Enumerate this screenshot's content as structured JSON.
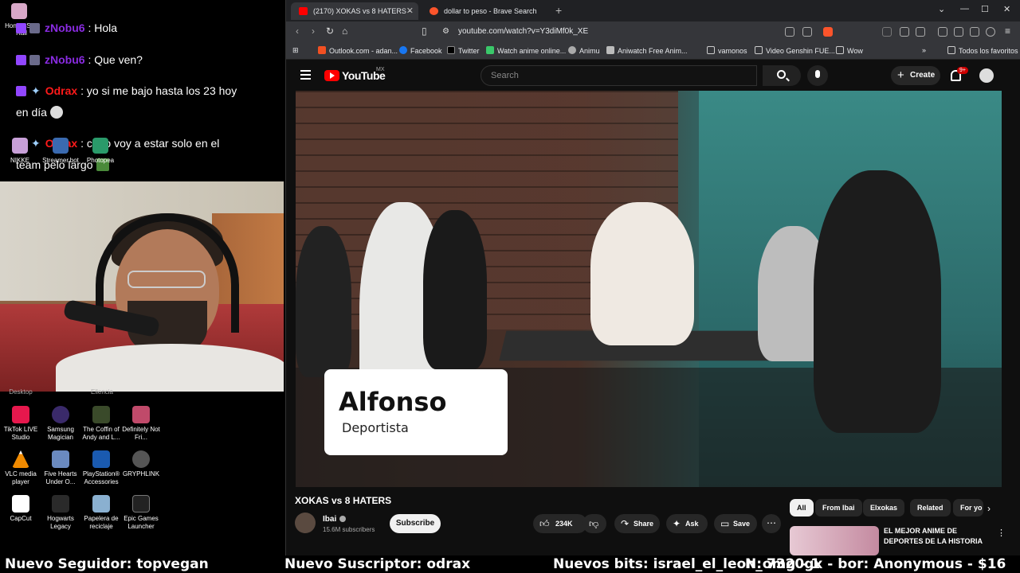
{
  "chat": [
    {
      "user": "zNobu6",
      "message": ": Hola"
    },
    {
      "user": "zNobu6",
      "message": ": Que ven?"
    },
    {
      "user": "Odrax",
      "message": ": yo si me bajo hasta los 23 hoy",
      "continuation": "en día"
    },
    {
      "user": "Odrax",
      "message": ": claro voy a estar solo en el",
      "continuation": "team pelo largo"
    }
  ],
  "desktop_top_icons": [
    {
      "label": "Honkai Star Rail"
    },
    {
      "label": "NIKKE"
    },
    {
      "label": "Streamer.bot"
    },
    {
      "label": "Photopea"
    }
  ],
  "desktop_partial_labels": [
    "Desktop",
    "Ellencia"
  ],
  "desktop_icons": [
    {
      "label": "TikTok LIVE Studio",
      "color": "#e6184d"
    },
    {
      "label": "Samsung Magician",
      "color": "#3a2a6a"
    },
    {
      "label": "The Coffin of Andy and L...",
      "color": "#3a4a2a"
    },
    {
      "label": "Definitely Not Fri...",
      "color": "#c04a6a"
    },
    {
      "label": "VLC media player",
      "color": "#f08a00"
    },
    {
      "label": "Five Hearts Under O...",
      "color": "#6a8ac0"
    },
    {
      "label": "PlayStation® Accessories",
      "color": "#1a5ab0"
    },
    {
      "label": "GRYPHLINK",
      "color": "#555"
    },
    {
      "label": "CapCut",
      "color": "#fff"
    },
    {
      "label": "Hogwarts Legacy",
      "color": "#2a2a2a"
    },
    {
      "label": "Papelera de reciclaje",
      "color": "#8ab0d0"
    },
    {
      "label": "Epic Games Launcher",
      "color": "#222"
    }
  ],
  "browser": {
    "tabs": [
      {
        "title": "(2170) XOKAS vs 8 HATERS - You",
        "active": true
      },
      {
        "title": "dollar to peso - Brave Search",
        "active": false
      }
    ],
    "url": "youtube.com/watch?v=Y3diMf0k_XE",
    "bookmarks": [
      "Outlook.com - adan...",
      "Facebook",
      "Twitter",
      "Watch anime online...",
      "Animu",
      "Aniwatch Free Anim...",
      "vamonos",
      "Video Genshin FUE...",
      "Wow",
      "Todos los favoritos"
    ],
    "brave_badge": "",
    "window_controls": [
      "⌄",
      "—",
      "☐",
      "✕"
    ]
  },
  "youtube": {
    "logo_text": "YouTube",
    "region": "MX",
    "search_placeholder": "Search",
    "create_label": "Create",
    "notifications": "9+",
    "video": {
      "lower_third_name": "Alfonso",
      "lower_third_role": "Deportista"
    },
    "title": "XOKAS vs 8 HATERS",
    "channel": "Ibai",
    "subscribers": "15.6M subscribers",
    "subscribe_label": "Subscribe",
    "likes": "234K",
    "share_label": "Share",
    "ask_label": "Ask",
    "save_label": "Save",
    "chips": [
      "All",
      "From Ibai",
      "Elxokas",
      "Related",
      "For yo"
    ],
    "recommended_title": "EL MEJOR ANIME DE DEPORTES DE LA HISTORIA"
  },
  "alerts": [
    "Nuevo Seguidor: topvegan",
    "Nuevo Suscriptor: odrax",
    "Nuevos bits: israel_el_leon_omg - 1",
    "N: 7320gx - bor: Anonymous - $16"
  ]
}
